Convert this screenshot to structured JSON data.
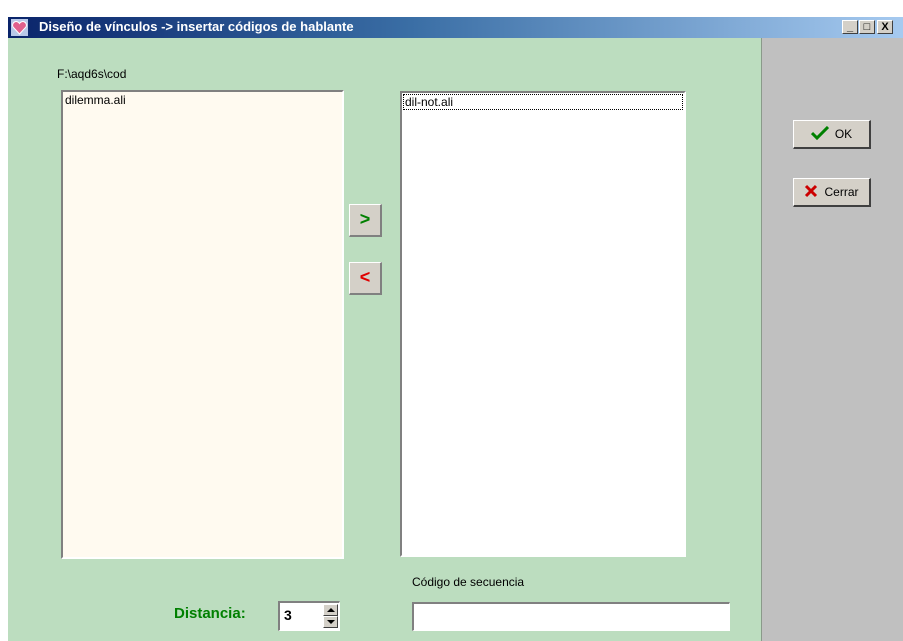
{
  "window": {
    "title": "Diseño de vínculos -> insertar códigos de hablante",
    "icon": "app-heart-icon",
    "controls": {
      "minimize": "_",
      "maximize": "□",
      "close": "X"
    }
  },
  "source": {
    "path": "F:\\aqd6s\\cod",
    "items": [
      "dilemma.ali"
    ]
  },
  "target": {
    "items": [
      "dil-not.ali"
    ]
  },
  "transfer": {
    "add_label": ">",
    "remove_label": "<"
  },
  "actions": {
    "ok_label": "OK",
    "cancel_label": "Cerrar"
  },
  "distance": {
    "label": "Distancia:",
    "value": "3"
  },
  "sequence": {
    "label": "Código de secuencia",
    "value": ""
  },
  "colors": {
    "client_bg": "#bcddbf",
    "accent_green": "#008000",
    "accent_red": "#e00000",
    "source_list_bg": "#fffaf0"
  }
}
